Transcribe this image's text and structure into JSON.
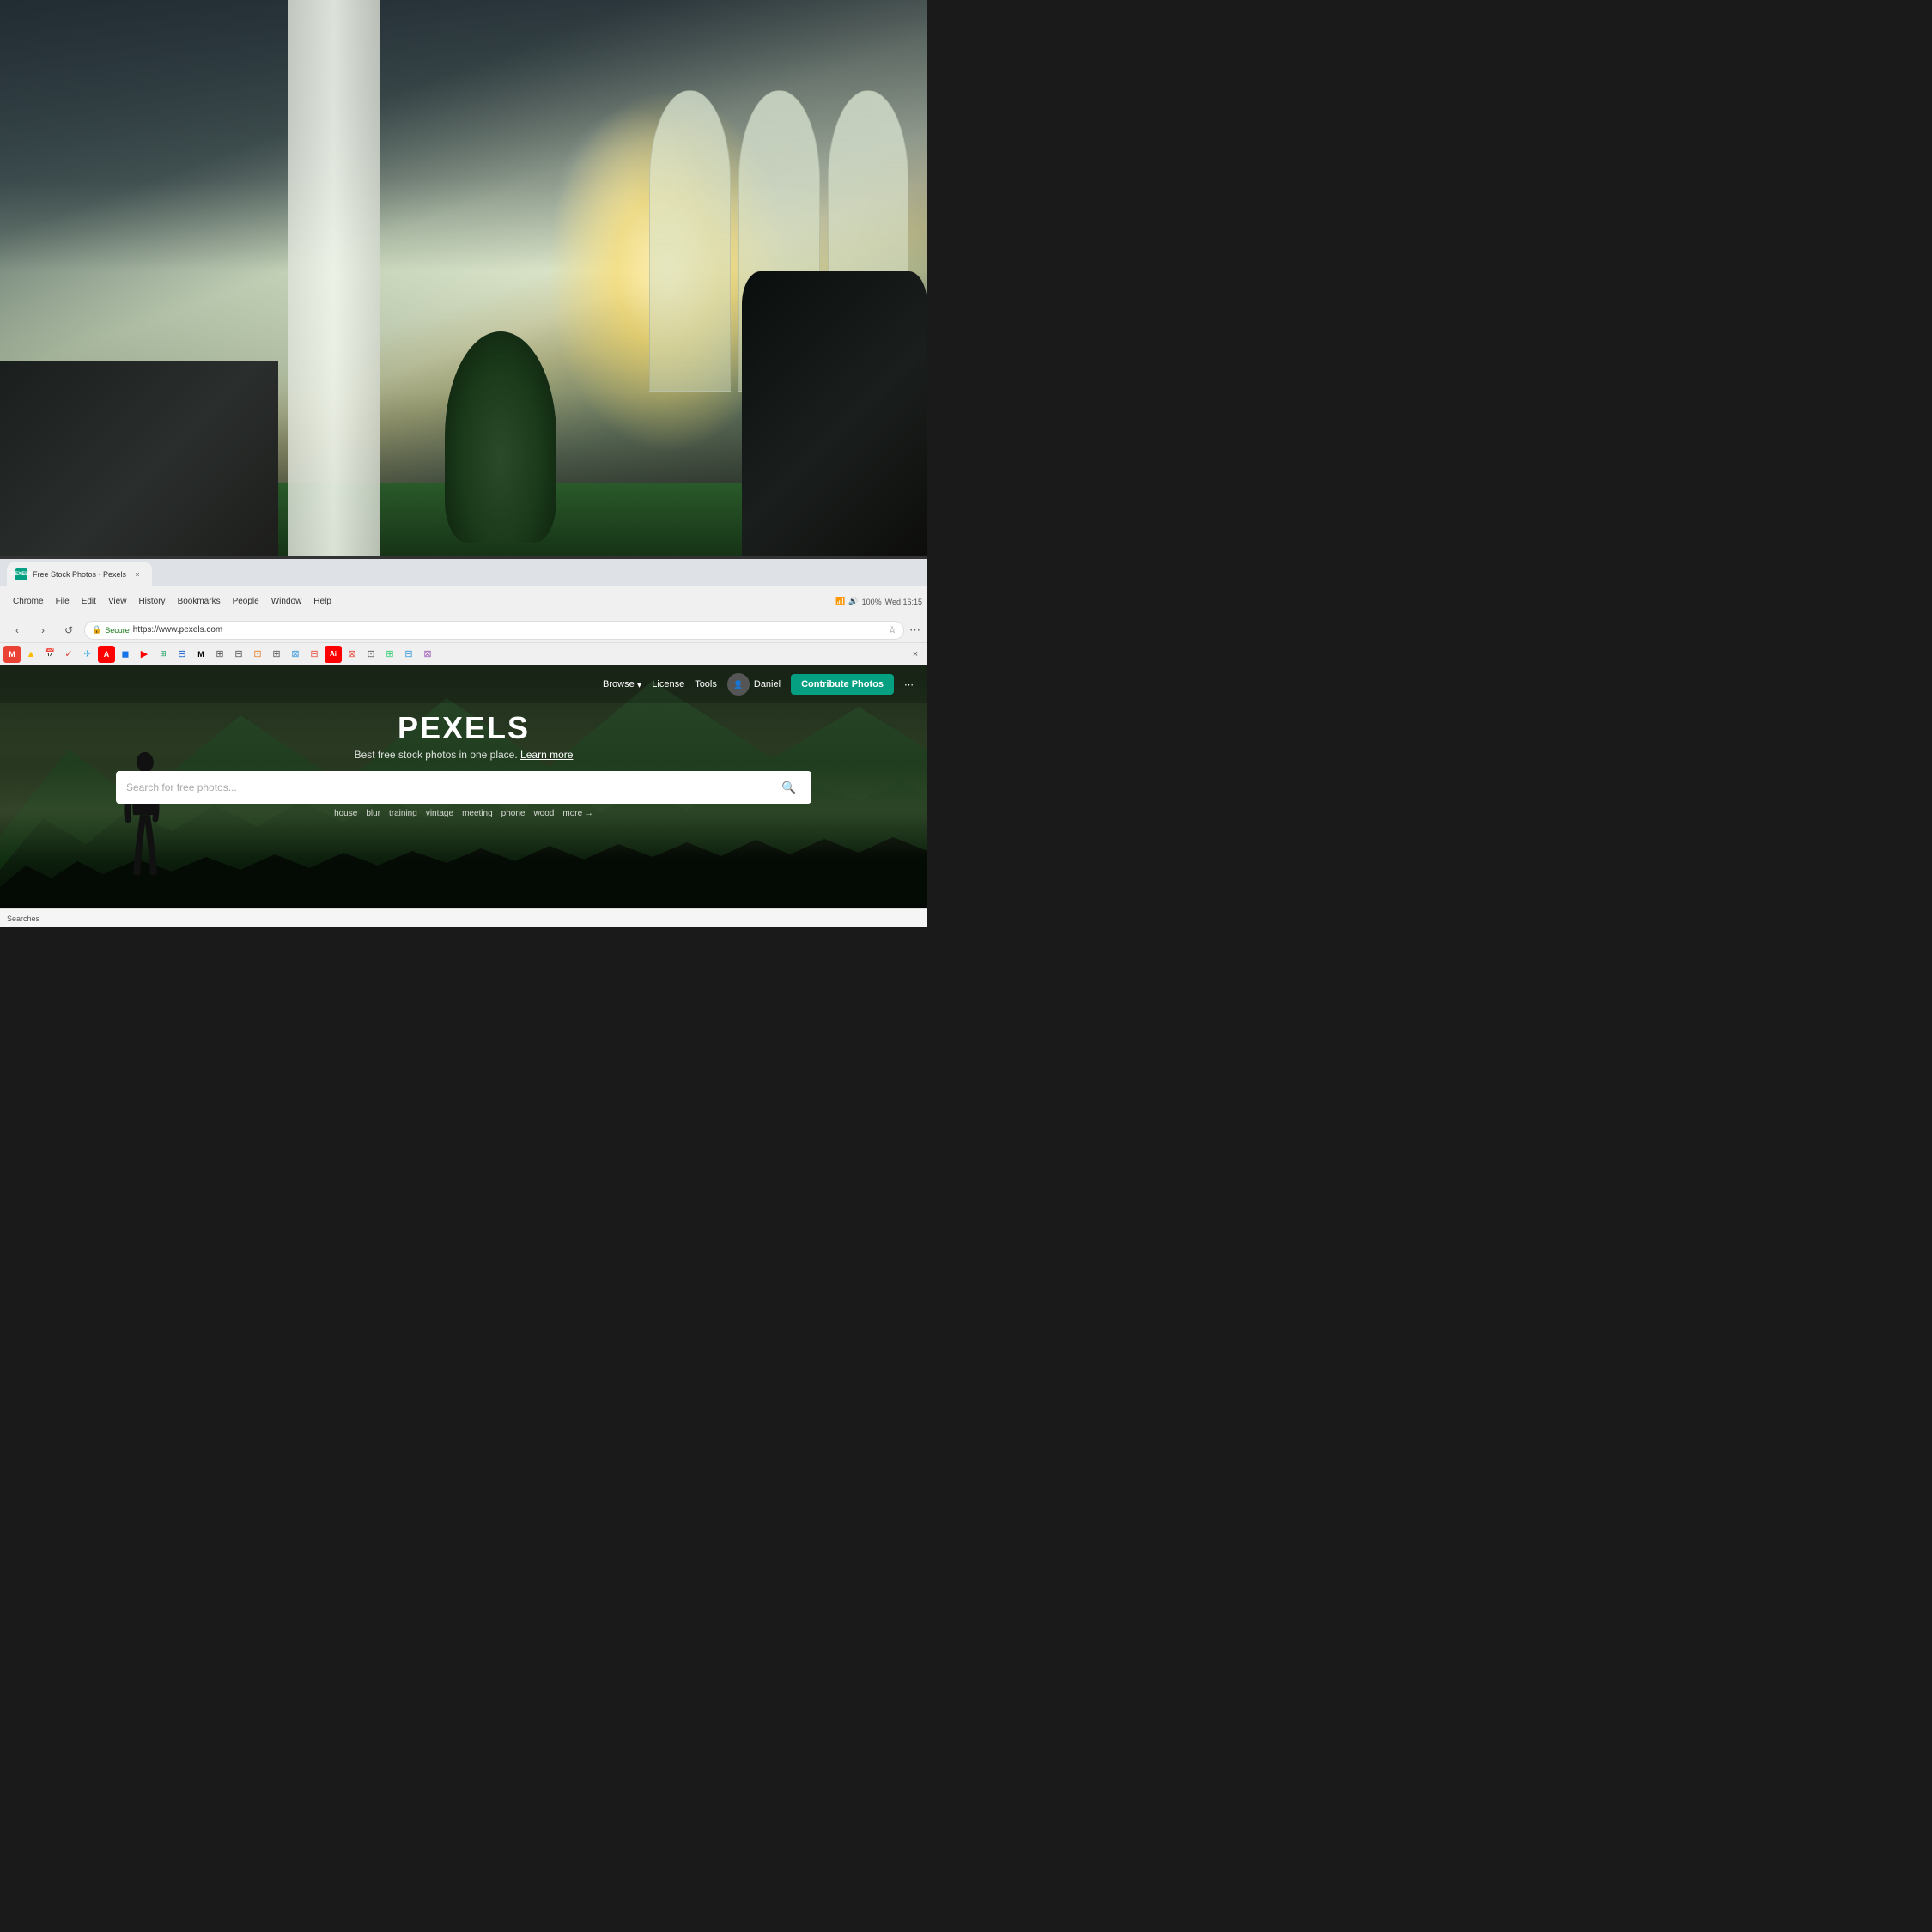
{
  "browser": {
    "tab": {
      "favicon_text": "P",
      "title": "Free Stock Photos · Pexels",
      "close_symbol": "×"
    },
    "toolbar": {
      "back_label": "‹",
      "forward_label": "›",
      "reload_label": "↺",
      "menu_items": [
        "Chrome",
        "File",
        "Edit",
        "View",
        "History",
        "Bookmarks",
        "People",
        "Window",
        "Help"
      ],
      "battery": "100%",
      "time": "Wed 16:15"
    },
    "address_bar": {
      "lock_icon": "🔒",
      "secure_label": "Secure",
      "url": "https://www.pexels.com",
      "bookmark_icon": "☆",
      "more_icon": "⋯"
    },
    "status_bar": {
      "text": "Searches"
    }
  },
  "pexels": {
    "nav": {
      "browse_label": "Browse",
      "browse_arrow": "▾",
      "license_label": "License",
      "tools_label": "Tools",
      "user_name": "Daniel",
      "contribute_label": "Contribute Photos",
      "more_icon": "⋯"
    },
    "hero": {
      "logo": "PEXELS",
      "tagline": "Best free stock photos in one place.",
      "learn_more": "Learn more",
      "search_placeholder": "Search for free photos...",
      "search_icon": "🔍"
    },
    "quick_tags": [
      "house",
      "blur",
      "training",
      "vintage",
      "meeting",
      "phone",
      "wood"
    ],
    "more_label": "more →"
  },
  "colors": {
    "contribute_btn_bg": "#05a081",
    "pexels_green": "#05a081",
    "secure_green": "#1a7a1a"
  }
}
